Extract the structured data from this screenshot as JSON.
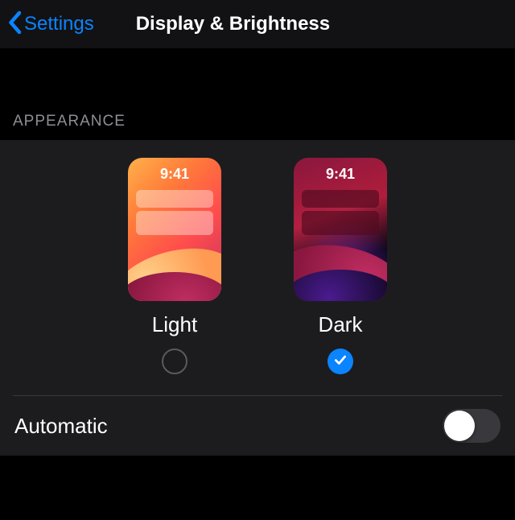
{
  "nav": {
    "back_label": "Settings",
    "title": "Display & Brightness"
  },
  "appearance": {
    "header": "APPEARANCE",
    "preview_time": "9:41",
    "options": [
      {
        "label": "Light",
        "selected": false
      },
      {
        "label": "Dark",
        "selected": true
      }
    ]
  },
  "automatic": {
    "label": "Automatic",
    "enabled": false
  },
  "colors": {
    "accent": "#0a84ff",
    "background": "#000000",
    "cell": "#1c1c1e",
    "secondary_text": "#8e8e93"
  }
}
